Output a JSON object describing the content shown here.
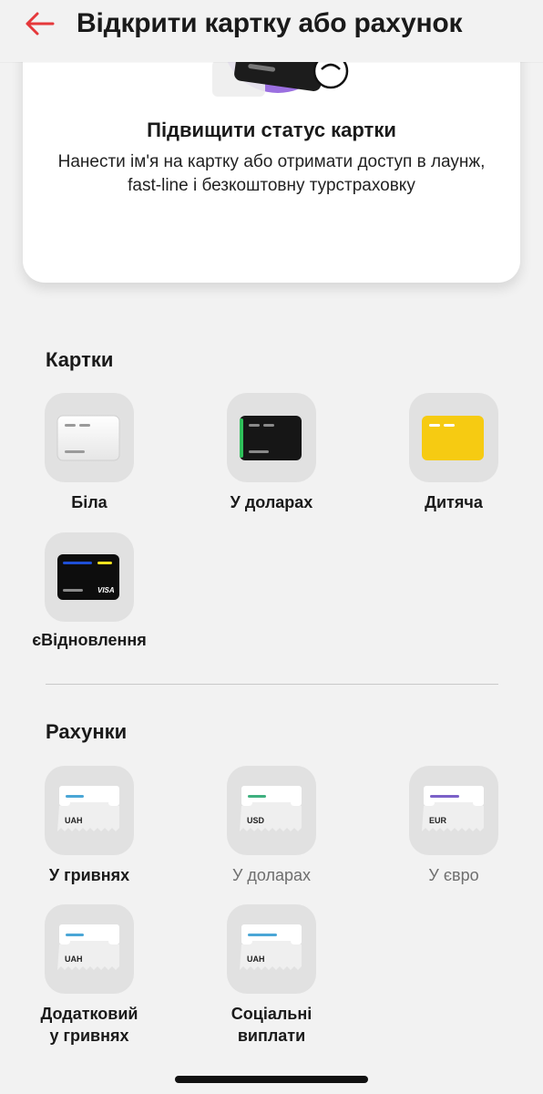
{
  "header": {
    "title": "Відкрити картку або рахунок",
    "back_icon": "arrow-left-icon",
    "accent_color": "#e5383b"
  },
  "promo": {
    "title": "Підвищити статус картки",
    "description": "Нанести ім'я на картку або отримати доступ в лаунж, fast-line і безкоштовну турстраховку"
  },
  "cards_section": {
    "title": "Картки",
    "items": [
      {
        "label": "Біла",
        "icon": "white-card-icon"
      },
      {
        "label": "У доларах",
        "icon": "black-card-green-stripe-icon"
      },
      {
        "label": "Дитяча",
        "icon": "yellow-card-icon"
      },
      {
        "label": "єВідновлення",
        "icon": "black-visa-card-icon",
        "brand": "VISA"
      }
    ]
  },
  "accounts_section": {
    "title": "Рахунки",
    "items": [
      {
        "label": "У гривнях",
        "currency": "UAH",
        "icon": "account-receipt-icon",
        "stripe_color": "#4aa6d6",
        "muted": false
      },
      {
        "label": "У доларах",
        "currency": "USD",
        "icon": "account-receipt-icon",
        "stripe_color": "#3fb07f",
        "muted": true
      },
      {
        "label": "У євро",
        "currency": "EUR",
        "icon": "account-receipt-icon",
        "stripe_color": "#7b61c8",
        "muted": true
      },
      {
        "label_line1": "Додатковий",
        "label_line2": "у гривнях",
        "currency": "UAH",
        "icon": "account-receipt-icon",
        "stripe_color": "#4aa6d6",
        "muted": false
      },
      {
        "label_line1": "Соціальні",
        "label_line2": "виплати",
        "currency": "UAH",
        "icon": "account-receipt-icon",
        "stripe_color": "#4aa6d6",
        "muted": false
      }
    ]
  }
}
